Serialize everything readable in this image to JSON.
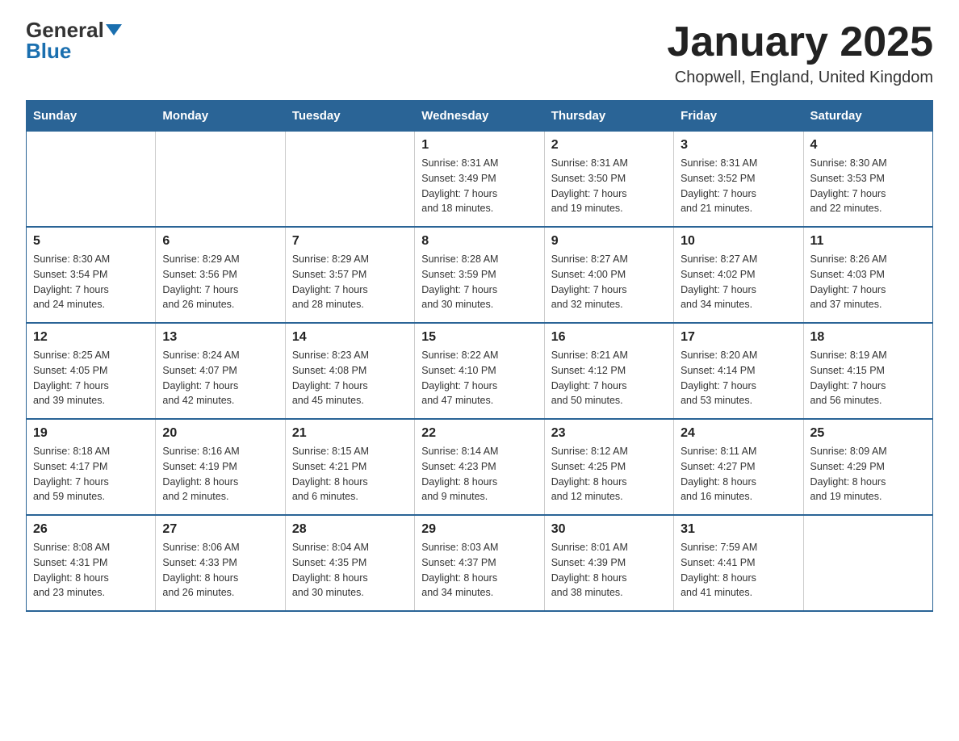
{
  "header": {
    "logo_general": "General",
    "logo_blue": "Blue",
    "title": "January 2025",
    "subtitle": "Chopwell, England, United Kingdom"
  },
  "weekdays": [
    "Sunday",
    "Monday",
    "Tuesday",
    "Wednesday",
    "Thursday",
    "Friday",
    "Saturday"
  ],
  "weeks": [
    [
      {
        "day": "",
        "info": ""
      },
      {
        "day": "",
        "info": ""
      },
      {
        "day": "",
        "info": ""
      },
      {
        "day": "1",
        "info": "Sunrise: 8:31 AM\nSunset: 3:49 PM\nDaylight: 7 hours\nand 18 minutes."
      },
      {
        "day": "2",
        "info": "Sunrise: 8:31 AM\nSunset: 3:50 PM\nDaylight: 7 hours\nand 19 minutes."
      },
      {
        "day": "3",
        "info": "Sunrise: 8:31 AM\nSunset: 3:52 PM\nDaylight: 7 hours\nand 21 minutes."
      },
      {
        "day": "4",
        "info": "Sunrise: 8:30 AM\nSunset: 3:53 PM\nDaylight: 7 hours\nand 22 minutes."
      }
    ],
    [
      {
        "day": "5",
        "info": "Sunrise: 8:30 AM\nSunset: 3:54 PM\nDaylight: 7 hours\nand 24 minutes."
      },
      {
        "day": "6",
        "info": "Sunrise: 8:29 AM\nSunset: 3:56 PM\nDaylight: 7 hours\nand 26 minutes."
      },
      {
        "day": "7",
        "info": "Sunrise: 8:29 AM\nSunset: 3:57 PM\nDaylight: 7 hours\nand 28 minutes."
      },
      {
        "day": "8",
        "info": "Sunrise: 8:28 AM\nSunset: 3:59 PM\nDaylight: 7 hours\nand 30 minutes."
      },
      {
        "day": "9",
        "info": "Sunrise: 8:27 AM\nSunset: 4:00 PM\nDaylight: 7 hours\nand 32 minutes."
      },
      {
        "day": "10",
        "info": "Sunrise: 8:27 AM\nSunset: 4:02 PM\nDaylight: 7 hours\nand 34 minutes."
      },
      {
        "day": "11",
        "info": "Sunrise: 8:26 AM\nSunset: 4:03 PM\nDaylight: 7 hours\nand 37 minutes."
      }
    ],
    [
      {
        "day": "12",
        "info": "Sunrise: 8:25 AM\nSunset: 4:05 PM\nDaylight: 7 hours\nand 39 minutes."
      },
      {
        "day": "13",
        "info": "Sunrise: 8:24 AM\nSunset: 4:07 PM\nDaylight: 7 hours\nand 42 minutes."
      },
      {
        "day": "14",
        "info": "Sunrise: 8:23 AM\nSunset: 4:08 PM\nDaylight: 7 hours\nand 45 minutes."
      },
      {
        "day": "15",
        "info": "Sunrise: 8:22 AM\nSunset: 4:10 PM\nDaylight: 7 hours\nand 47 minutes."
      },
      {
        "day": "16",
        "info": "Sunrise: 8:21 AM\nSunset: 4:12 PM\nDaylight: 7 hours\nand 50 minutes."
      },
      {
        "day": "17",
        "info": "Sunrise: 8:20 AM\nSunset: 4:14 PM\nDaylight: 7 hours\nand 53 minutes."
      },
      {
        "day": "18",
        "info": "Sunrise: 8:19 AM\nSunset: 4:15 PM\nDaylight: 7 hours\nand 56 minutes."
      }
    ],
    [
      {
        "day": "19",
        "info": "Sunrise: 8:18 AM\nSunset: 4:17 PM\nDaylight: 7 hours\nand 59 minutes."
      },
      {
        "day": "20",
        "info": "Sunrise: 8:16 AM\nSunset: 4:19 PM\nDaylight: 8 hours\nand 2 minutes."
      },
      {
        "day": "21",
        "info": "Sunrise: 8:15 AM\nSunset: 4:21 PM\nDaylight: 8 hours\nand 6 minutes."
      },
      {
        "day": "22",
        "info": "Sunrise: 8:14 AM\nSunset: 4:23 PM\nDaylight: 8 hours\nand 9 minutes."
      },
      {
        "day": "23",
        "info": "Sunrise: 8:12 AM\nSunset: 4:25 PM\nDaylight: 8 hours\nand 12 minutes."
      },
      {
        "day": "24",
        "info": "Sunrise: 8:11 AM\nSunset: 4:27 PM\nDaylight: 8 hours\nand 16 minutes."
      },
      {
        "day": "25",
        "info": "Sunrise: 8:09 AM\nSunset: 4:29 PM\nDaylight: 8 hours\nand 19 minutes."
      }
    ],
    [
      {
        "day": "26",
        "info": "Sunrise: 8:08 AM\nSunset: 4:31 PM\nDaylight: 8 hours\nand 23 minutes."
      },
      {
        "day": "27",
        "info": "Sunrise: 8:06 AM\nSunset: 4:33 PM\nDaylight: 8 hours\nand 26 minutes."
      },
      {
        "day": "28",
        "info": "Sunrise: 8:04 AM\nSunset: 4:35 PM\nDaylight: 8 hours\nand 30 minutes."
      },
      {
        "day": "29",
        "info": "Sunrise: 8:03 AM\nSunset: 4:37 PM\nDaylight: 8 hours\nand 34 minutes."
      },
      {
        "day": "30",
        "info": "Sunrise: 8:01 AM\nSunset: 4:39 PM\nDaylight: 8 hours\nand 38 minutes."
      },
      {
        "day": "31",
        "info": "Sunrise: 7:59 AM\nSunset: 4:41 PM\nDaylight: 8 hours\nand 41 minutes."
      },
      {
        "day": "",
        "info": ""
      }
    ]
  ]
}
